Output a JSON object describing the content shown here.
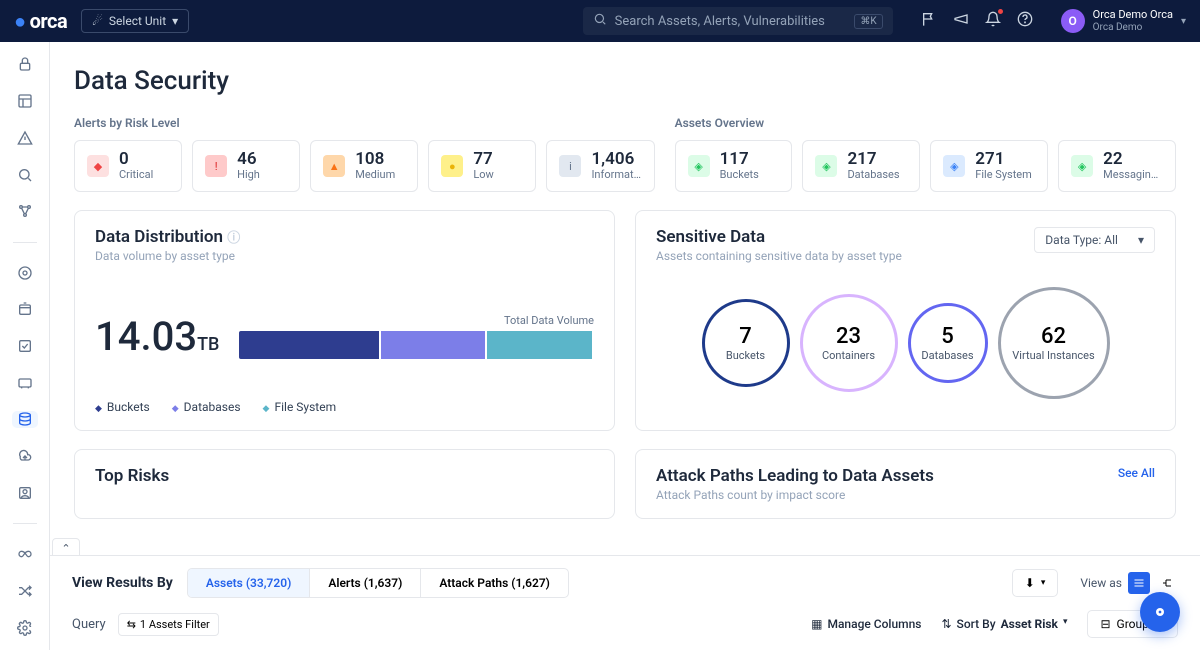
{
  "brand": "orca",
  "unit_selector": "Select Unit",
  "search_placeholder": "Search Assets, Alerts, Vulnerabilities",
  "search_shortcut": "⌘K",
  "user": {
    "initial": "O",
    "name": "Orca Demo Orca",
    "org": "Orca Demo"
  },
  "page_title": "Data Security",
  "alerts_label": "Alerts by Risk Level",
  "alerts": [
    {
      "n": "0",
      "l": "Critical",
      "bg": "#fde0e0",
      "fg": "#ef4444",
      "glyph": "◆"
    },
    {
      "n": "46",
      "l": "High",
      "bg": "#fecaca",
      "fg": "#dc2626",
      "glyph": "!"
    },
    {
      "n": "108",
      "l": "Medium",
      "bg": "#fed7aa",
      "fg": "#f97316",
      "glyph": "▲"
    },
    {
      "n": "77",
      "l": "Low",
      "bg": "#fef08a",
      "fg": "#eab308",
      "glyph": "●"
    },
    {
      "n": "1,406",
      "l": "Informatio...",
      "bg": "#e2e8f0",
      "fg": "#64748b",
      "glyph": "i"
    }
  ],
  "assets_label": "Assets Overview",
  "assets": [
    {
      "n": "117",
      "l": "Buckets",
      "bg": "#dcfce7",
      "fg": "#22c55e"
    },
    {
      "n": "217",
      "l": "Databases",
      "bg": "#dcfce7",
      "fg": "#22c55e"
    },
    {
      "n": "271",
      "l": "File System",
      "bg": "#dbeafe",
      "fg": "#3b82f6"
    },
    {
      "n": "22",
      "l": "Messaging and ...",
      "bg": "#dcfce7",
      "fg": "#22c55e"
    }
  ],
  "distribution": {
    "title": "Data Distribution",
    "sub": "Data volume by asset type",
    "total_label": "Total Data Volume",
    "value": "14.03",
    "unit": "TB",
    "legend": [
      "Buckets",
      "Databases",
      "File System"
    ]
  },
  "chart_data": {
    "type": "bar",
    "orientation": "stacked-horizontal",
    "title": "Data Distribution",
    "total_label": "Total Data Volume",
    "total_value_tb": 14.03,
    "series": [
      {
        "name": "Buckets",
        "percent": 40,
        "color": "#2e3d8f"
      },
      {
        "name": "Databases",
        "percent": 30,
        "color": "#7c7ee8"
      },
      {
        "name": "File System",
        "percent": 30,
        "color": "#5bb5c9"
      }
    ]
  },
  "sensitive": {
    "title": "Sensitive Data",
    "sub": "Assets containing sensitive data by asset type",
    "filter": "Data Type: All",
    "circles": [
      {
        "n": "7",
        "l": "Buckets",
        "size": 88,
        "border": "#1e3a8a"
      },
      {
        "n": "23",
        "l": "Containers",
        "size": 98,
        "border": "#d8b4fe"
      },
      {
        "n": "5",
        "l": "Databases",
        "size": 80,
        "border": "#6366f1"
      },
      {
        "n": "62",
        "l": "Virtual Instances",
        "size": 112,
        "border": "#9ca3af"
      }
    ]
  },
  "top_risks": {
    "title": "Top Risks"
  },
  "attack_paths": {
    "title": "Attack Paths Leading to Data Assets",
    "sub": "Attack Paths count by impact score",
    "see_all": "See All"
  },
  "results": {
    "label": "View Results By",
    "tabs": [
      {
        "l": "Assets (33,720)",
        "active": true
      },
      {
        "l": "Alerts (1,637)",
        "active": false
      },
      {
        "l": "Attack Paths (1,627)",
        "active": false
      }
    ],
    "view_as_label": "View as"
  },
  "query": {
    "label": "Query",
    "filter_pill": "1 Assets Filter",
    "manage_cols": "Manage Columns",
    "sort_by_label": "Sort By",
    "sort_by_value": "Asset Risk",
    "group_by": "Group By"
  }
}
